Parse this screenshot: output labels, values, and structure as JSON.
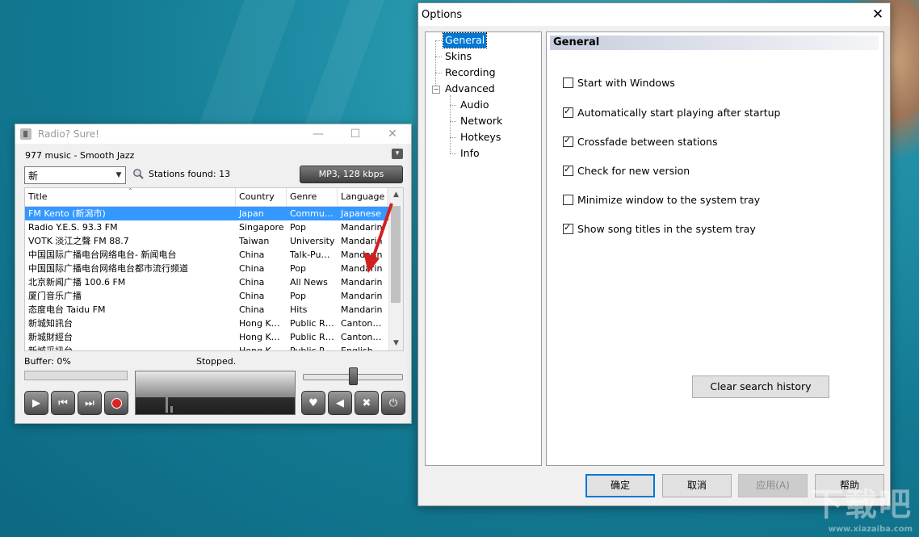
{
  "radio": {
    "title": "Radio? Sure!",
    "station_playing": "977 music - Smooth Jazz",
    "search_value": "新",
    "stations_found": "Stations found: 13",
    "format": "MP3, 128 kbps",
    "columns": [
      "Title",
      "Country",
      "Genre",
      "Language"
    ],
    "rows": [
      {
        "title": "FM Kento (新潟市)",
        "country": "Japan",
        "genre": "Commu…",
        "language": "Japanese"
      },
      {
        "title": "Radio Y.E.S. 93.3 FM",
        "country": "Singapore",
        "genre": "Pop",
        "language": "Mandarin"
      },
      {
        "title": "VOTK 淡江之聲 FM 88.7",
        "country": "Taiwan",
        "genre": "University",
        "language": "Mandarin"
      },
      {
        "title": "中国国际广播电台网络电台- 新闻电台",
        "country": "China",
        "genre": "Talk-Pu…",
        "language": "Mandarin"
      },
      {
        "title": "中国国际广播电台网络电台都市流行频道",
        "country": "China",
        "genre": "Pop",
        "language": "Mandarin"
      },
      {
        "title": "北京新闻广播 100.6 FM",
        "country": "China",
        "genre": "All News",
        "language": "Mandarin"
      },
      {
        "title": "厦门音乐广播",
        "country": "China",
        "genre": "Pop",
        "language": "Mandarin"
      },
      {
        "title": "态度电台 Taidu FM",
        "country": "China",
        "genre": "Hits",
        "language": "Mandarin"
      },
      {
        "title": "新城知訊台",
        "country": "Hong K…",
        "genre": "Public R…",
        "language": "Canton…"
      },
      {
        "title": "新城財經台",
        "country": "Hong K…",
        "genre": "Public R…",
        "language": "Canton…"
      },
      {
        "title": "新城采訊台",
        "country": "Hong K…",
        "genre": "Public R…",
        "language": "English"
      }
    ],
    "buffer": "Buffer: 0%",
    "status": "Stopped.",
    "buffer_fraction": 0,
    "volume_fraction": 0.5,
    "controls": {
      "play": "▶",
      "prev": "⏮",
      "next": "⏭",
      "heart": "♥",
      "mute": "◀",
      "tools": "✖",
      "power": "⏻"
    },
    "icons": [
      "app-icon",
      "mini-window-icon",
      "search-icon",
      "play-icon",
      "previous-icon",
      "next-icon",
      "record-icon",
      "heart-icon",
      "speaker-icon",
      "tools-icon",
      "power-icon"
    ]
  },
  "options": {
    "title": "Options",
    "tree": [
      "General",
      "Skins",
      "Recording",
      "Advanced",
      "Audio",
      "Network",
      "Hotkeys",
      "Info"
    ],
    "selected": "General",
    "panel_title": "General",
    "checkboxes": [
      {
        "label": "Start with Windows",
        "checked": false
      },
      {
        "label": "Automatically start playing after startup",
        "checked": true
      },
      {
        "label": "Crossfade between stations",
        "checked": true
      },
      {
        "label": "Check for new version",
        "checked": true
      },
      {
        "label": "Minimize window to the system tray",
        "checked": false
      },
      {
        "label": "Show song titles in the system tray",
        "checked": true
      }
    ],
    "clear_history": "Clear search history",
    "buttons": {
      "ok": "确定",
      "cancel": "取消",
      "apply": "应用(A)",
      "help": "帮助"
    }
  },
  "colors": {
    "selection": "#3399ff",
    "tree_selection": "#0078d7",
    "annotation_arrow": "#d41f1f"
  },
  "watermark": {
    "main": "下载吧",
    "sub": "www.xiazaiba.com"
  }
}
